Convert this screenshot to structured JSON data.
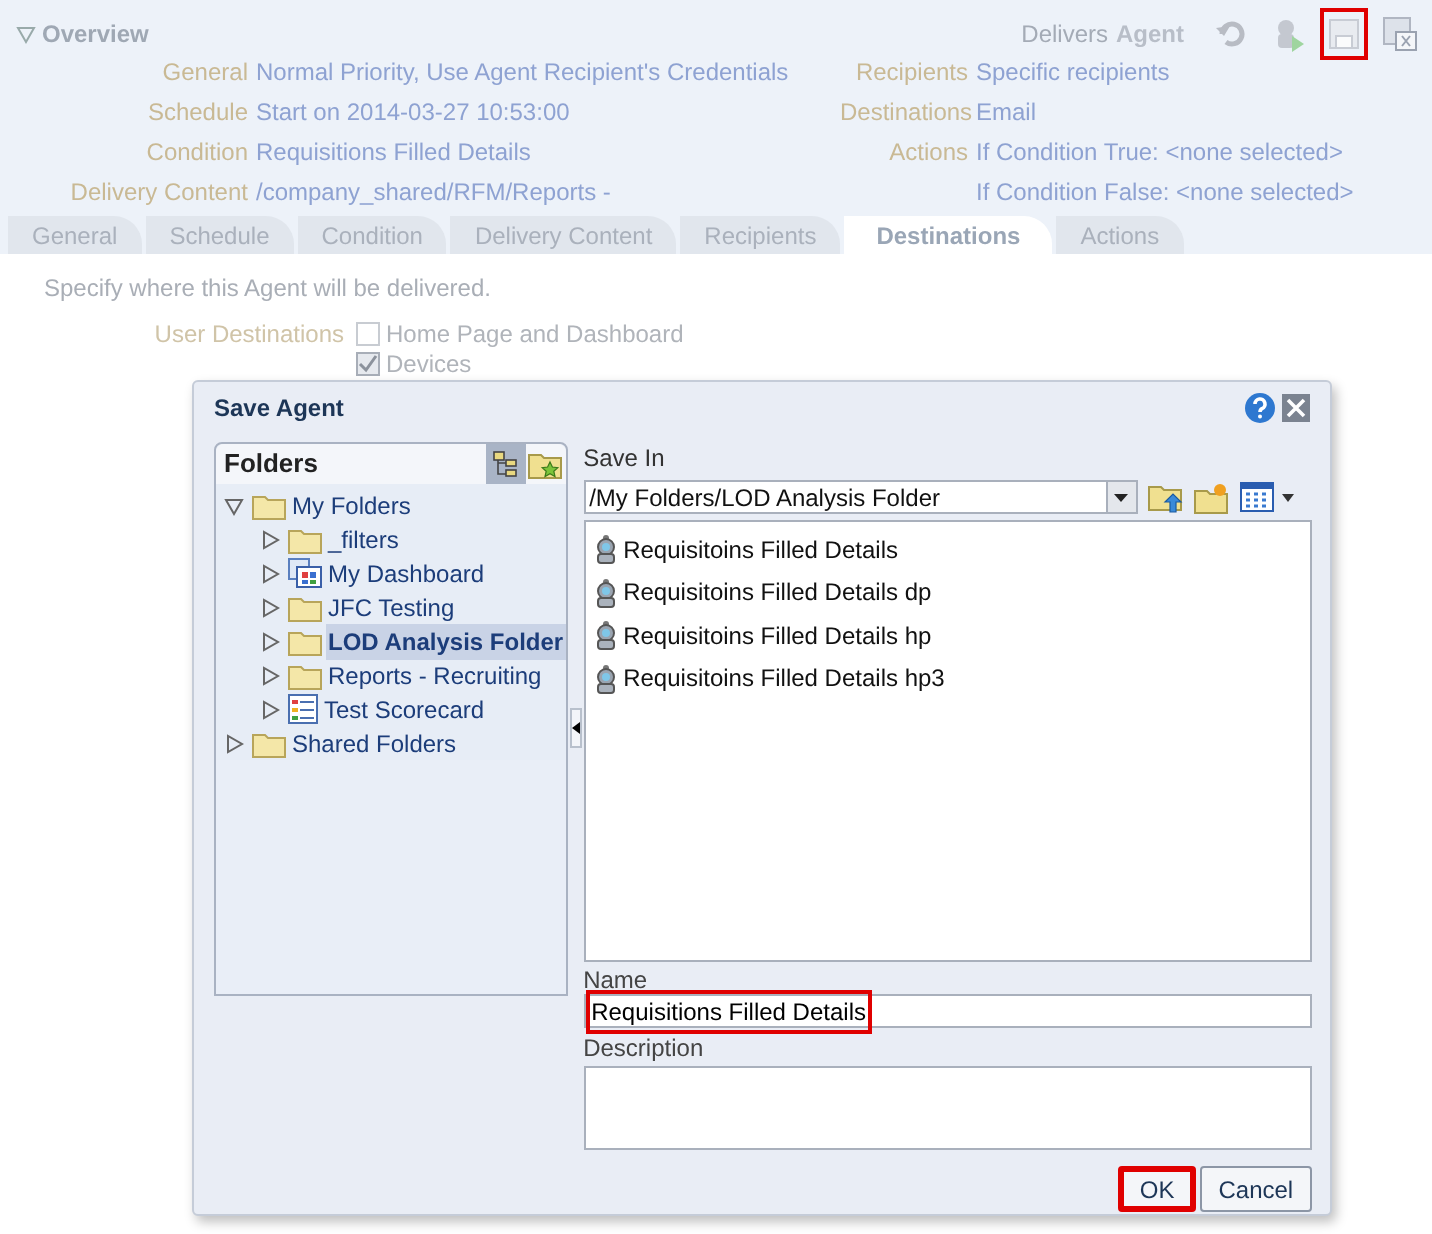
{
  "overview": {
    "title": "Overview",
    "expanded": true,
    "delivers_label": "Delivers",
    "delivers_value": "Agent",
    "toolbar": [
      {
        "kind": "revert",
        "highlighted": false
      },
      {
        "kind": "run",
        "highlighted": false
      },
      {
        "kind": "save",
        "highlighted": true
      },
      {
        "kind": "save_as",
        "highlighted": false
      }
    ],
    "left_rows": [
      {
        "label": "General",
        "value": "Normal Priority, Use Agent Recipient's Credentials"
      },
      {
        "label": "Schedule",
        "value": "Start on 2014-03-27 10:53:00"
      },
      {
        "label": "Condition",
        "value": "Requisitions Filled Details"
      },
      {
        "label": "Delivery Content",
        "value": "/company_shared/RFM/Reports -"
      }
    ],
    "right_rows": [
      {
        "label": "Recipients",
        "value": "Specific recipients"
      },
      {
        "label": "Destinations",
        "value": "Email"
      },
      {
        "label": "Actions",
        "value": "If Condition True: <none selected>"
      },
      {
        "value": "If Condition False: <none selected>"
      }
    ]
  },
  "tabs": [
    {
      "label": "General",
      "selected": false
    },
    {
      "label": "Schedule",
      "selected": false
    },
    {
      "label": "Condition",
      "selected": false
    },
    {
      "label": "Delivery Content",
      "selected": false
    },
    {
      "label": "Recipients",
      "selected": false
    },
    {
      "label": "Destinations",
      "selected": true
    },
    {
      "label": "Actions",
      "selected": false
    }
  ],
  "destinations": {
    "intro": "Specify where this Agent will be delivered.",
    "label": "User Destinations",
    "options": [
      {
        "label": "Home Page and Dashboard",
        "checked": false
      },
      {
        "label": "Devices",
        "checked": true
      }
    ]
  },
  "dialog": {
    "title": "Save Agent",
    "folders_title": "Folders",
    "tree": [
      {
        "label": "My Folders",
        "kind": "folder",
        "expanded": true,
        "selected": false,
        "children": [
          {
            "label": "_filters",
            "kind": "folder",
            "expanded": false,
            "selected": false
          },
          {
            "label": "My Dashboard",
            "kind": "dashboard",
            "expanded": false,
            "selected": false
          },
          {
            "label": "JFC Testing",
            "kind": "folder",
            "expanded": false,
            "selected": false
          },
          {
            "label": "LOD Analysis Folder",
            "kind": "folder",
            "expanded": false,
            "selected": true
          },
          {
            "label": "Reports - Recruiting",
            "kind": "folder",
            "expanded": false,
            "selected": false
          },
          {
            "label": "Test Scorecard",
            "kind": "scorecard",
            "expanded": false,
            "selected": false
          }
        ]
      },
      {
        "label": "Shared Folders",
        "kind": "folder",
        "expanded": false,
        "selected": false
      }
    ],
    "save_in_label": "Save In",
    "save_in_value": "/My Folders/LOD Analysis Folder",
    "items": [
      "Requisitoins Filled Details",
      "Requisitoins Filled Details dp",
      "Requisitoins Filled Details hp",
      "Requisitoins Filled Details hp3"
    ],
    "name_label": "Name",
    "name_value": "Requisitions Filled Details",
    "name_highlighted": true,
    "description_label": "Description",
    "buttons": [
      {
        "label": "OK",
        "highlighted": true
      },
      {
        "label": "Cancel",
        "highlighted": false
      }
    ]
  }
}
